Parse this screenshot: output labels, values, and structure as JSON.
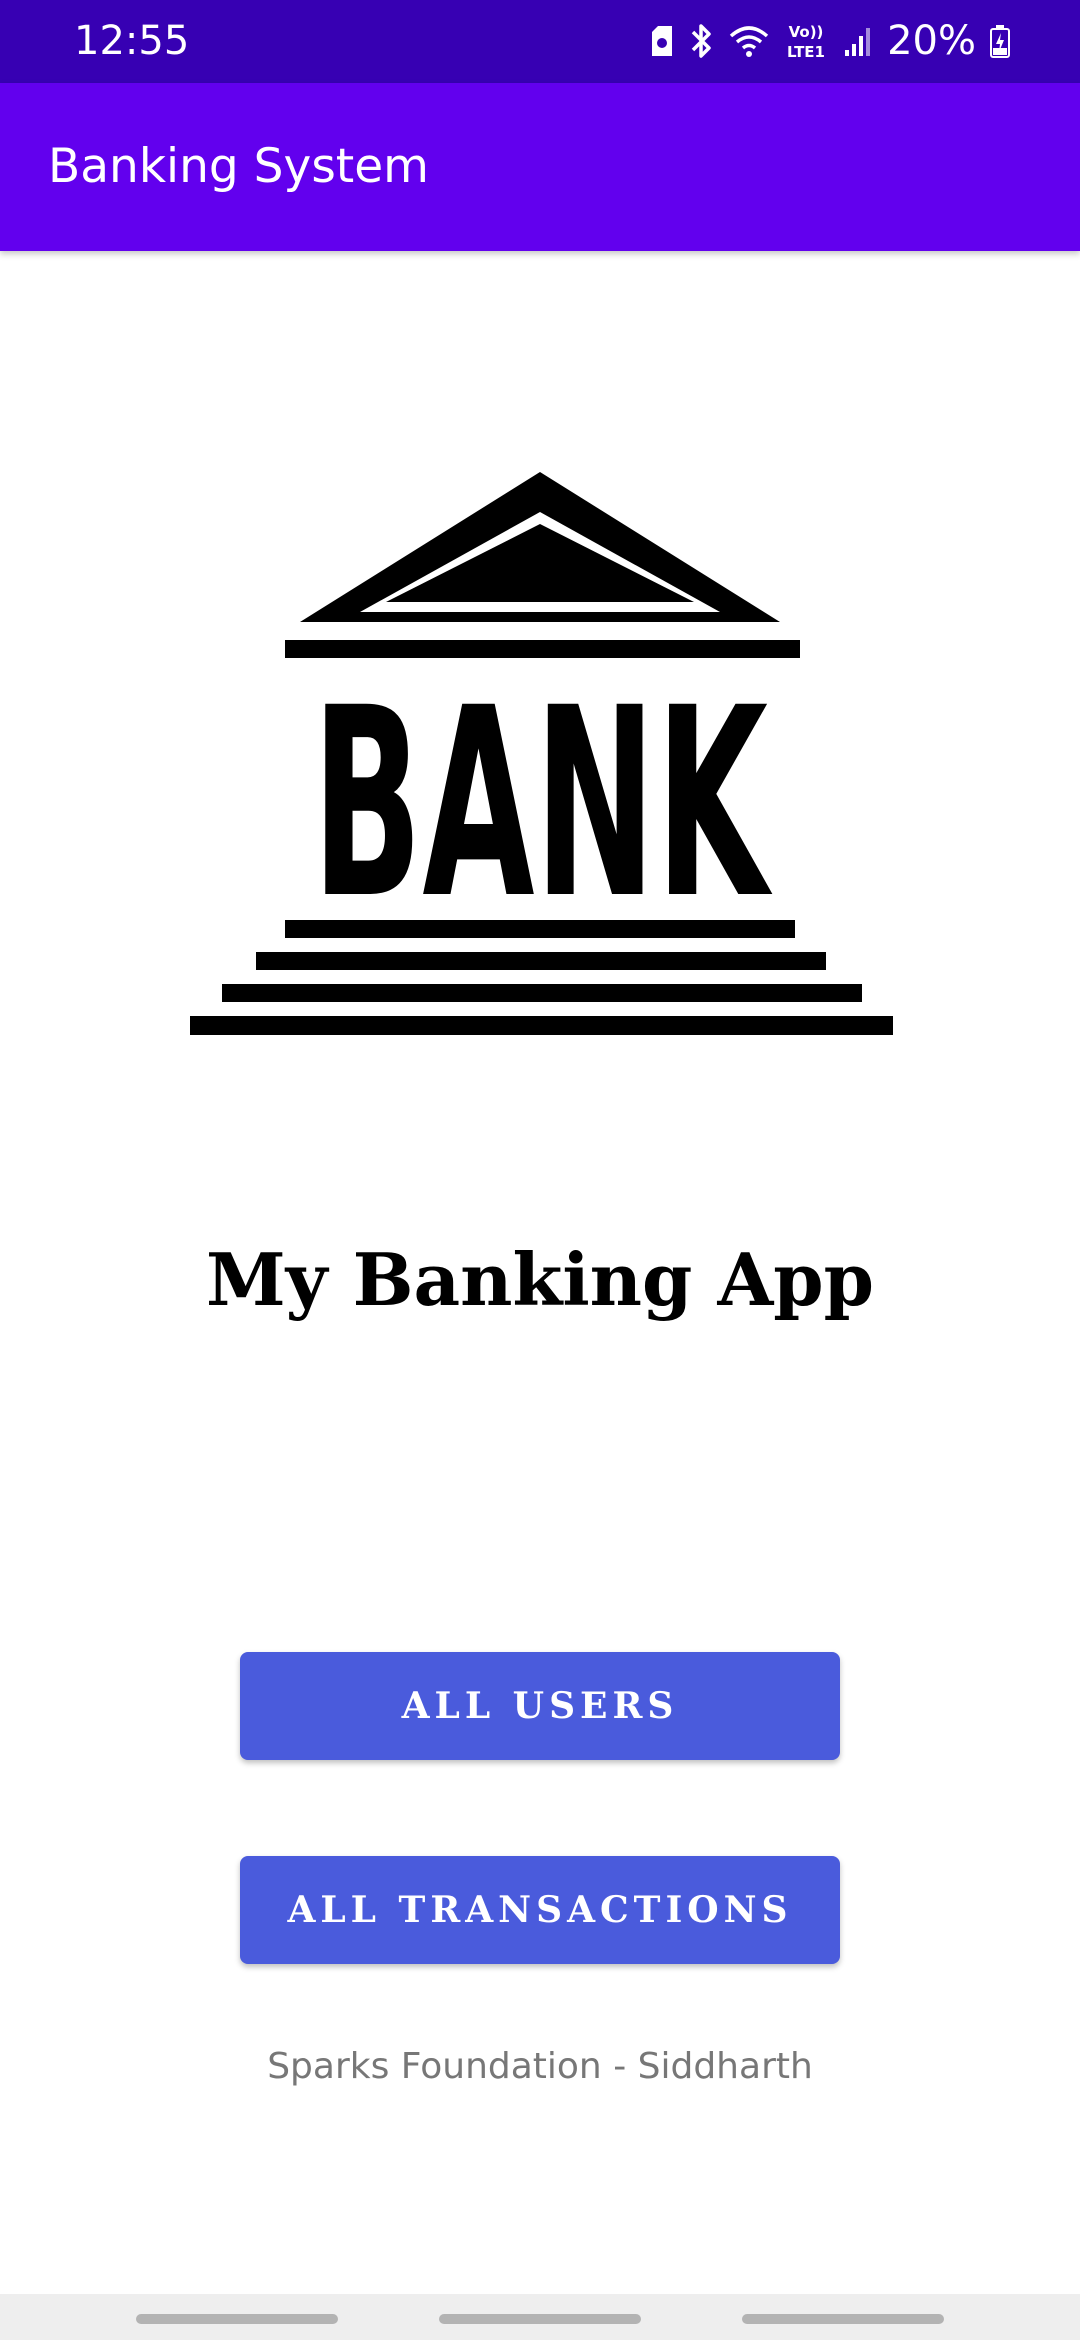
{
  "status_bar": {
    "time": "12:55",
    "battery_percent": "20%",
    "network_label_top": "Vo))",
    "network_label_bottom": "LTE1",
    "icons": [
      "sim-manager-icon",
      "bluetooth-icon",
      "wifi-icon",
      "volte-icon",
      "signal-icon",
      "battery-charging-icon"
    ]
  },
  "app_bar": {
    "title": "Banking System"
  },
  "logo": {
    "text": "BANK",
    "icon": "bank-building-icon"
  },
  "main": {
    "heading": "My Banking App",
    "buttons": {
      "all_users": "ALL USERS",
      "all_transactions": "ALL TRANSACTIONS"
    },
    "footer": "Sparks Foundation - Siddharth"
  },
  "colors": {
    "status_bar": "#3700b3",
    "app_bar": "#6200ee",
    "button": "#4a5bdc",
    "footer_text": "#777777"
  }
}
